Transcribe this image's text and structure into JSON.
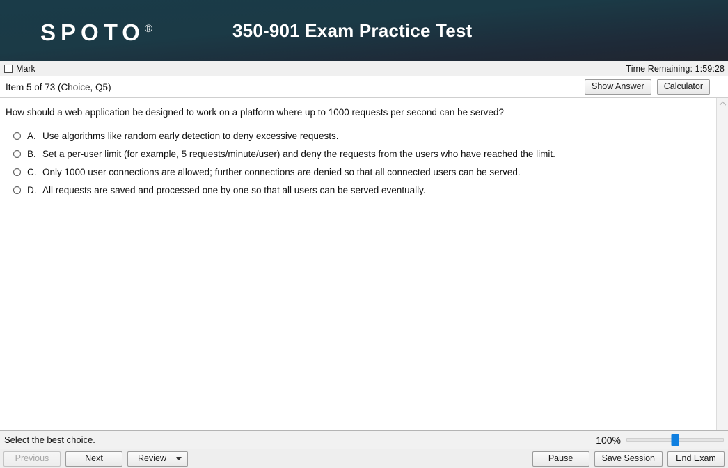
{
  "header": {
    "logo_text": "SPOTO",
    "logo_registered": "®",
    "title": "350-901 Exam Practice Test"
  },
  "statusbar": {
    "mark_label": "Mark",
    "mark_checked": false,
    "timer_label": "Time Remaining: 1:59:28"
  },
  "itembar": {
    "item_label": "Item 5 of 73  (Choice, Q5)",
    "show_answer_label": "Show Answer",
    "calculator_label": "Calculator"
  },
  "question": {
    "text": "How should a web application be designed to work on a platform where up to 1000 requests per second can be served?",
    "options": [
      {
        "letter": "A.",
        "text": "Use algorithms like random early detection to deny excessive requests.",
        "selected": false
      },
      {
        "letter": "B.",
        "text": "Set a per-user limit (for example, 5 requests/minute/user) and deny the requests from the users who have reached the limit.",
        "selected": false
      },
      {
        "letter": "C.",
        "text": "Only 1000 user connections are allowed; further connections are denied so that all connected users can be served.",
        "selected": false
      },
      {
        "letter": "D.",
        "text": "All requests are saved and processed one by one so that all users can be served eventually.",
        "selected": false
      }
    ]
  },
  "footer": {
    "prompt": "Select the best choice.",
    "zoom_percent": "100%",
    "zoom_value": 50,
    "previous_label": "Previous",
    "previous_disabled": true,
    "next_label": "Next",
    "review_label": "Review",
    "pause_label": "Pause",
    "save_session_label": "Save Session",
    "end_exam_label": "End Exam"
  },
  "colors": {
    "header_top": "#1a3b48",
    "header_bottom": "#20252f",
    "slider_handle": "#0f7fe0"
  }
}
